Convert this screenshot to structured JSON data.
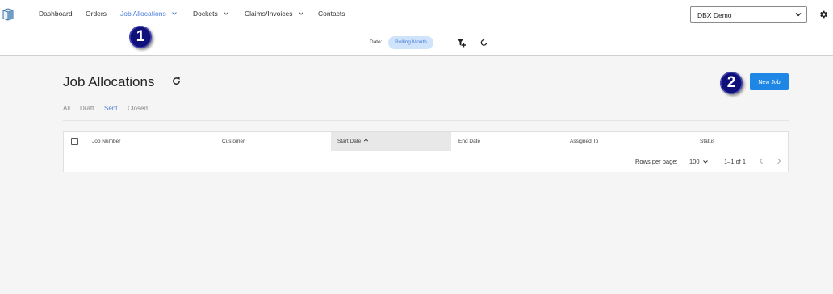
{
  "nav": {
    "items": [
      {
        "label": "Dashboard",
        "has_dropdown": false,
        "active": false
      },
      {
        "label": "Orders",
        "has_dropdown": false,
        "active": false
      },
      {
        "label": "Job Allocations",
        "has_dropdown": true,
        "active": true
      },
      {
        "label": "Dockets",
        "has_dropdown": true,
        "active": false
      },
      {
        "label": "Claims/Invoices",
        "has_dropdown": true,
        "active": false
      },
      {
        "label": "Contacts",
        "has_dropdown": false,
        "active": false
      }
    ],
    "tenant_select": {
      "value": "DBX Demo"
    },
    "icons": {
      "logo": "box-logo-icon",
      "settings": "gear-icon"
    }
  },
  "filter_bar": {
    "date_label": "Date:",
    "date_chip": "Rolling Month",
    "icons": {
      "filter": "filter-add-icon",
      "reset": "reset-icon"
    }
  },
  "page": {
    "title": "Job Allocations",
    "new_job_label": "New Job"
  },
  "annotations": {
    "badge_1": "1",
    "badge_2": "2"
  },
  "tabs": [
    {
      "label": "All",
      "active": false
    },
    {
      "label": "Draft",
      "active": false
    },
    {
      "label": "Sent",
      "active": true
    },
    {
      "label": "Closed",
      "active": false
    }
  ],
  "table": {
    "columns": [
      "Job Number",
      "Customer",
      "Start Date",
      "End Date",
      "Assigned To",
      "Status"
    ],
    "sorted_column": "Start Date",
    "sort_direction": "ascending",
    "rows": [],
    "footer": {
      "rows_per_page_label": "Rows per page:",
      "rows_per_page_value": "100",
      "range": "1–1 of 1"
    }
  },
  "colors": {
    "accent": "#4a7fd8",
    "primary_button": "#1e87e5",
    "chip_bg": "#cfe3fb",
    "badge": "#10107a",
    "page_bg": "#f5f5f5"
  }
}
